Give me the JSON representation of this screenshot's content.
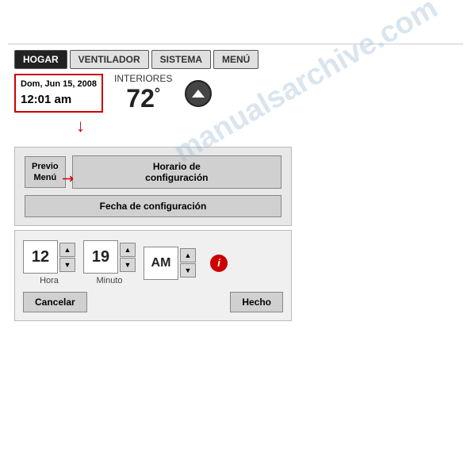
{
  "watermark": {
    "text": "manualsarchive.com"
  },
  "nav": {
    "tabs": [
      {
        "label": "HOGAR",
        "active": true
      },
      {
        "label": "VENTILADOR",
        "active": false
      },
      {
        "label": "SISTEMA",
        "active": false
      },
      {
        "label": "MENÚ",
        "active": false
      }
    ]
  },
  "dateBox": {
    "line1": "Dom, Jun 15, 2008",
    "line2": "12:01 am"
  },
  "interior": {
    "label": "INTERIORES",
    "temp": "72",
    "unit": "°"
  },
  "section2": {
    "previo_line1": "Previo",
    "previo_line2": "Menú",
    "horario": "Horario de\nconfiguración",
    "fecha": "Fecha de configuración"
  },
  "section3": {
    "hour": "12",
    "hour_label": "Hora",
    "minute": "19",
    "minute_label": "Minuto",
    "ampm": "AM",
    "cancel_label": "Cancelar",
    "done_label": "Hecho",
    "up_arrow": "▲",
    "down_arrow": "▼"
  }
}
